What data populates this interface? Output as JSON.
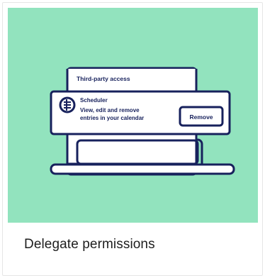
{
  "card": {
    "title": "Delegate permissions",
    "background_color": "#92e3be",
    "ink_color": "#17215c"
  },
  "illustration": {
    "window_title": "Third-party access",
    "app_name": "Scheduler",
    "app_description_line1": "View, edit and remove",
    "app_description_line2": "entries in your calendar",
    "remove_button_label": "Remove",
    "app_icon": "calendar-list-icon"
  }
}
